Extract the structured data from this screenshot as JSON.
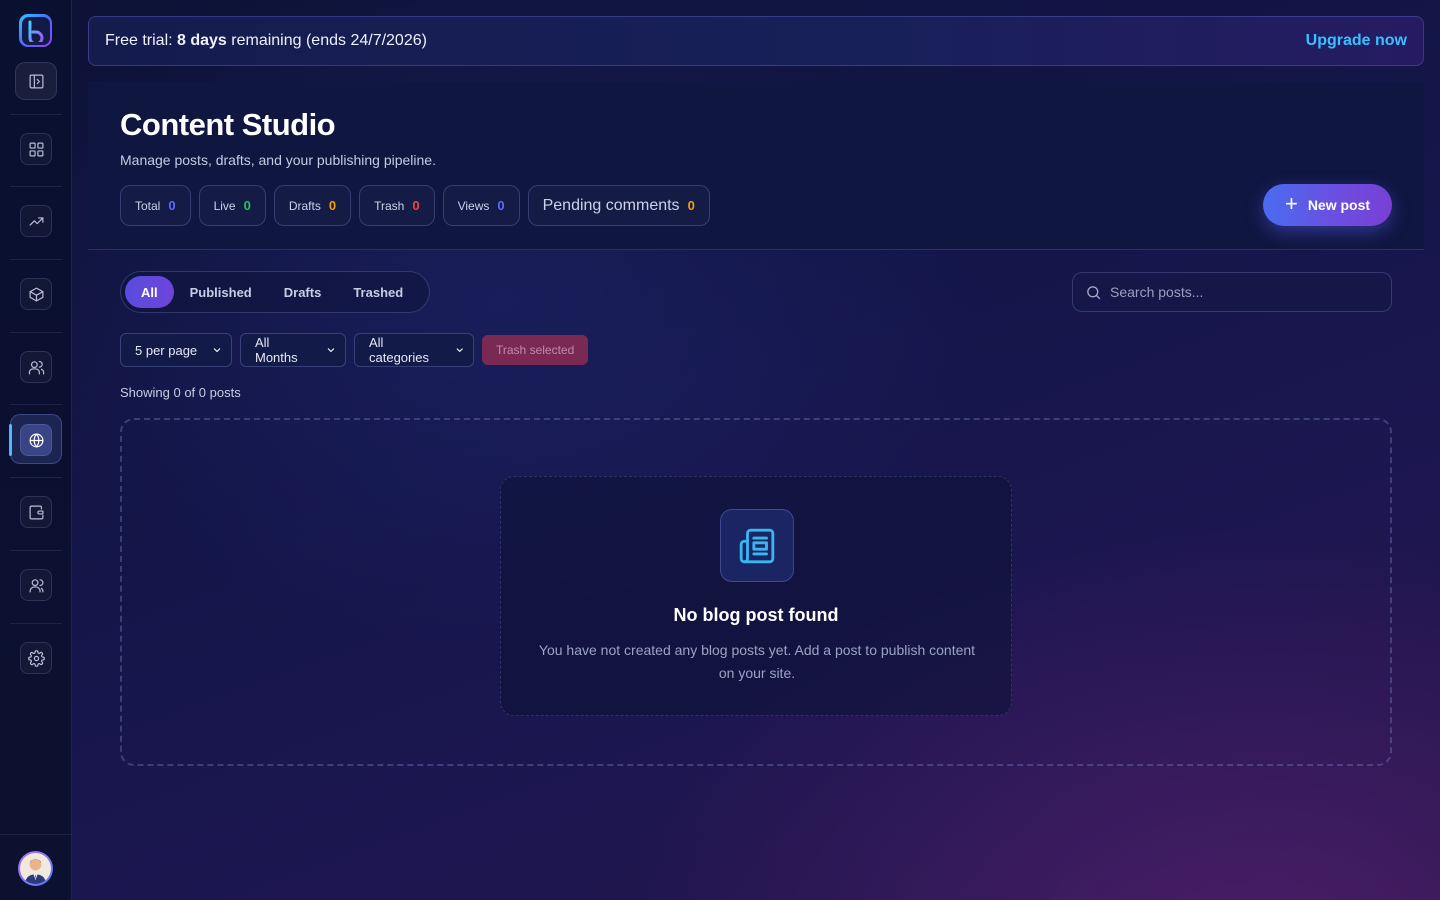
{
  "sidebar": {
    "items": [
      {
        "icon": "dashboard-icon"
      },
      {
        "icon": "trending-up-icon"
      },
      {
        "icon": "box-icon"
      },
      {
        "icon": "users-icon"
      },
      {
        "icon": "globe-icon",
        "active": true
      },
      {
        "icon": "wallet-icon"
      },
      {
        "icon": "team-icon"
      },
      {
        "icon": "gear-icon"
      }
    ]
  },
  "trial": {
    "prefix": "Free trial: ",
    "days": "8 days",
    "suffix": " remaining (ends 24/7/2026)",
    "upgrade_label": "Upgrade now"
  },
  "header": {
    "title": "Content Studio",
    "subtitle": "Manage posts, drafts, and your publishing pipeline.",
    "new_post_label": "New post"
  },
  "stats": [
    {
      "label": "Total",
      "value": "0",
      "color": "#5b6cff"
    },
    {
      "label": "Live",
      "value": "0",
      "color": "#22c55e"
    },
    {
      "label": "Drafts",
      "value": "0",
      "color": "#f59e0b"
    },
    {
      "label": "Trash",
      "value": "0",
      "color": "#ef4444"
    },
    {
      "label": "Views",
      "value": "0",
      "color": "#5b6cff"
    },
    {
      "label": "Pending comments",
      "value": "0",
      "color": "#f59e0b"
    }
  ],
  "tabs": [
    "All",
    "Published",
    "Drafts",
    "Trashed"
  ],
  "search": {
    "placeholder": "Search posts..."
  },
  "filters": {
    "per_page": "5 per page",
    "months": "All Months",
    "categories": "All categories",
    "trash_selected": "Trash selected"
  },
  "showing": "Showing 0 of 0 posts",
  "empty": {
    "title": "No blog post found",
    "description": "You have not created any blog posts yet. Add a post to publish content on your site."
  }
}
